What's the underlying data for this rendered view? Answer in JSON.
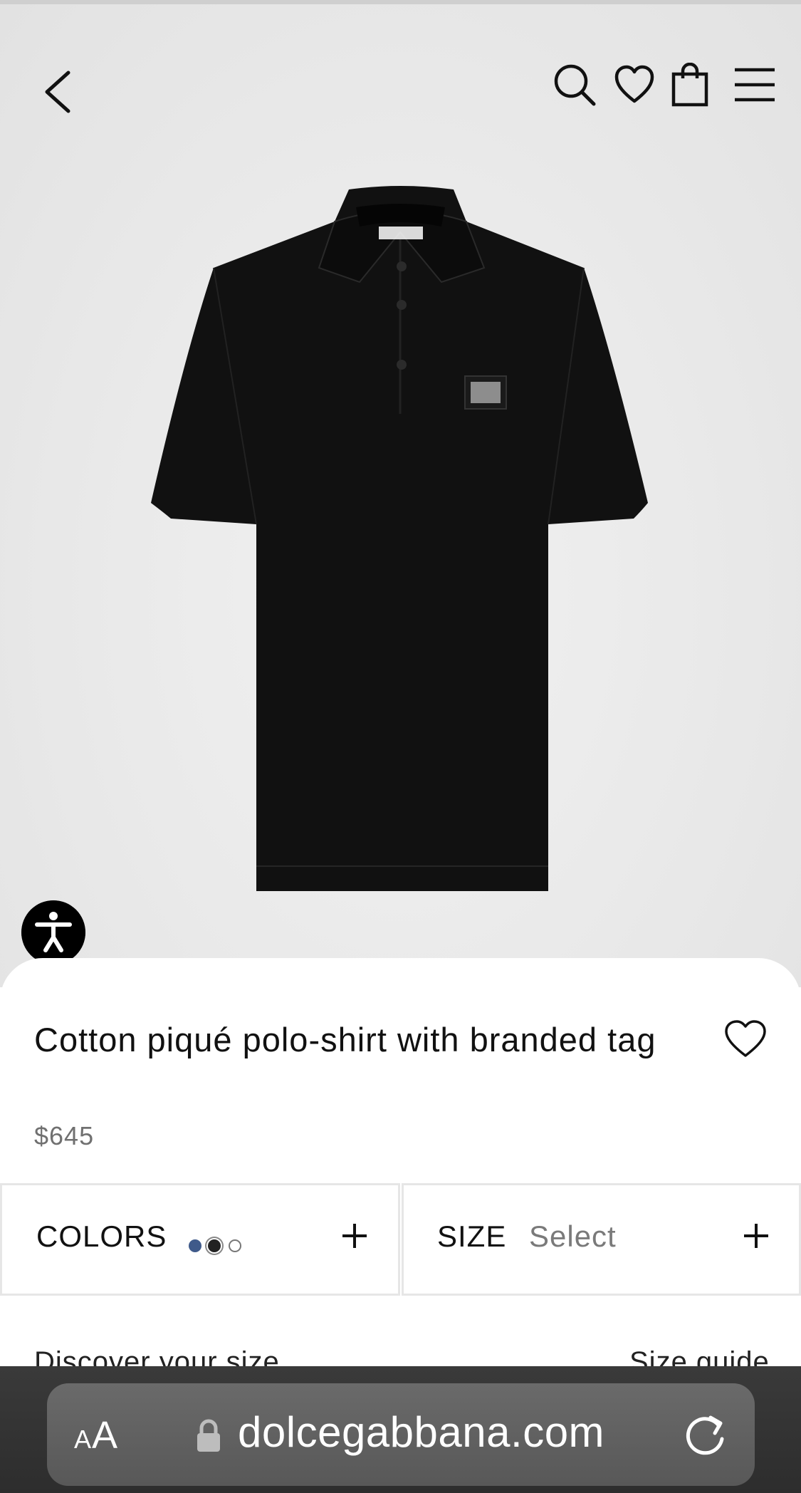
{
  "header": {
    "back_icon": "chevron-left-icon",
    "search_icon": "search-icon",
    "wishlist_icon": "heart-icon",
    "bag_icon": "shopping-bag-icon",
    "menu_icon": "hamburger-menu-icon"
  },
  "hero": {
    "image": "black-polo-shirt",
    "accessibility_icon": "accessibility-icon"
  },
  "product": {
    "title": "Cotton piqué polo-shirt with branded tag",
    "price": "$645",
    "wishlist_icon": "heart-icon"
  },
  "options": {
    "colors_label": "COLORS",
    "colors": [
      "#3f5a8a",
      "#222222",
      "#ffffff"
    ],
    "size_label": "SIZE",
    "size_value": "Select",
    "expand_icon": "plus-icon"
  },
  "below": {
    "discover_text": "Discover your size",
    "guide_text": "Size guide"
  },
  "browser": {
    "aa_small": "A",
    "aa_big": "A",
    "lock_icon": "lock-icon",
    "domain": "dolcegabbana.com",
    "reload_icon": "reload-icon"
  }
}
